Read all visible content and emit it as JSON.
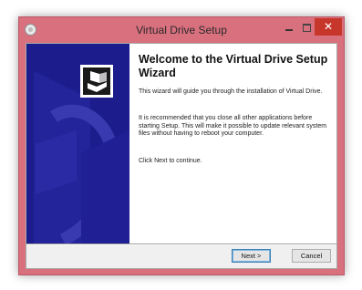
{
  "window": {
    "title": "Virtual Drive Setup",
    "close_glyph": "✕"
  },
  "content": {
    "heading": "Welcome to the Virtual Drive Setup Wizard",
    "para1": "This wizard will guide you through the installation of Virtual Drive.",
    "para2": "It is recommended that you close all other applications before starting Setup. This will make it possible to update relevant system files without having to reboot your computer.",
    "para3": "Click Next to continue."
  },
  "buttons": {
    "next_label": "Next >",
    "cancel_label": "Cancel"
  },
  "colors": {
    "titlebar": "#d9707e",
    "close_button": "#c7362b",
    "banner": "#1c1c8c"
  },
  "icons": [
    "app-icon",
    "minimize-icon",
    "maximize-icon",
    "close-icon",
    "installer-box-icon"
  ]
}
